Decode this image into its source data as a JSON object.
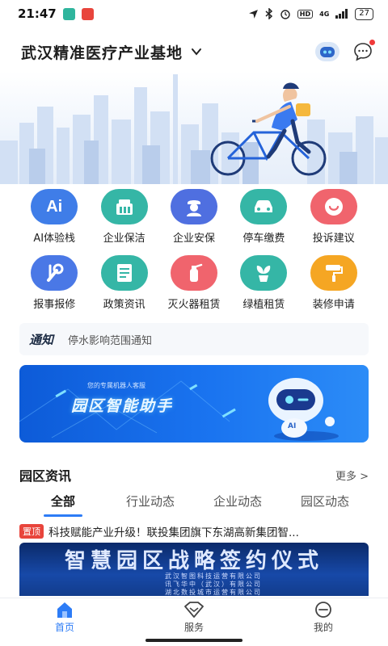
{
  "status_bar": {
    "time": "21:47",
    "network": "4G",
    "battery": "27"
  },
  "header": {
    "title": "武汉精准医疗产业基地"
  },
  "grid_row1": [
    {
      "label": "AI体验栈",
      "icon": "ai-icon",
      "color": "#3f7de8"
    },
    {
      "label": "企业保洁",
      "icon": "building-icon",
      "color": "#35b6a6"
    },
    {
      "label": "企业安保",
      "icon": "security-guard-icon",
      "color": "#4f6fe0"
    },
    {
      "label": "停车缴费",
      "icon": "car-icon",
      "color": "#35b6a6"
    },
    {
      "label": "投诉建议",
      "icon": "smile-icon",
      "color": "#f0646d"
    }
  ],
  "grid_row2": [
    {
      "label": "报事报修",
      "icon": "wrench-icon",
      "color": "#4a78e6"
    },
    {
      "label": "政策资讯",
      "icon": "document-icon",
      "color": "#35b6a6"
    },
    {
      "label": "灭火器租赁",
      "icon": "extinguisher-icon",
      "color": "#f0646d"
    },
    {
      "label": "绿植租赁",
      "icon": "plant-icon",
      "color": "#35b6a6"
    },
    {
      "label": "装修申请",
      "icon": "paint-roller-icon",
      "color": "#f5a623"
    }
  ],
  "notice": {
    "tag": "通知",
    "text": "停水影响范围通知"
  },
  "promo": {
    "subtitle": "您的专属机器人客服",
    "title": "园区智能助手",
    "robot_label": "AI"
  },
  "news_section": {
    "title": "园区资讯",
    "more": "更多 >",
    "tabs": [
      "全部",
      "行业动态",
      "企业动态",
      "园区动态"
    ],
    "top_badge": "置顶",
    "first_headline": "科技赋能产业升级！联投集团旗下东湖高新集团智...",
    "image_title": "智慧园区战略签约仪式",
    "image_lines": [
      "武汉智图科技运营有限公司",
      "讯飞华中（武汉）有限公司",
      "湖北数投城市运营有限公司"
    ]
  },
  "tabbar": [
    {
      "label": "首页",
      "icon": "home-icon"
    },
    {
      "label": "服务",
      "icon": "service-icon"
    },
    {
      "label": "我的",
      "icon": "profile-icon"
    }
  ],
  "colors": {
    "accent": "#2d7cf6",
    "badge_red": "#e8453c"
  }
}
